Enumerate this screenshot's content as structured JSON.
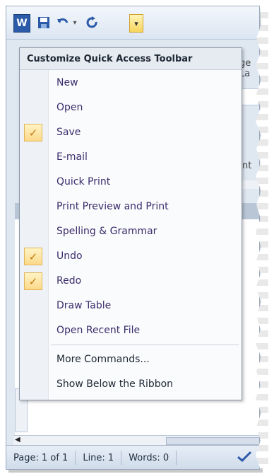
{
  "qat": {
    "word_letter": "W",
    "customize_glyph": "▾"
  },
  "background": {
    "ribbon_tab_partial": "ge La",
    "ribbon_group_partial": "nt"
  },
  "menu": {
    "title": "Customize Quick Access Toolbar",
    "items": [
      {
        "label": "New",
        "checked": false
      },
      {
        "label": "Open",
        "checked": false
      },
      {
        "label": "Save",
        "checked": true
      },
      {
        "label": "E-mail",
        "checked": false
      },
      {
        "label": "Quick Print",
        "checked": false
      },
      {
        "label": "Print Preview and Print",
        "checked": false
      },
      {
        "label": "Spelling & Grammar",
        "checked": false
      },
      {
        "label": "Undo",
        "checked": true
      },
      {
        "label": "Redo",
        "checked": true
      },
      {
        "label": "Draw Table",
        "checked": false
      },
      {
        "label": "Open Recent File",
        "checked": false
      }
    ],
    "commands": [
      {
        "label": "More Commands..."
      },
      {
        "label": "Show Below the Ribbon"
      }
    ],
    "check_glyph": "✓"
  },
  "status_bar": {
    "page": "Page: 1 of 1",
    "line": "Line: 1",
    "words": "Words: 0"
  },
  "icons": {
    "word": "word-icon",
    "save": "save-icon",
    "undo": "undo-icon",
    "redo": "redo-icon",
    "customize": "chevron-down-icon",
    "proofing": "check-icon"
  }
}
